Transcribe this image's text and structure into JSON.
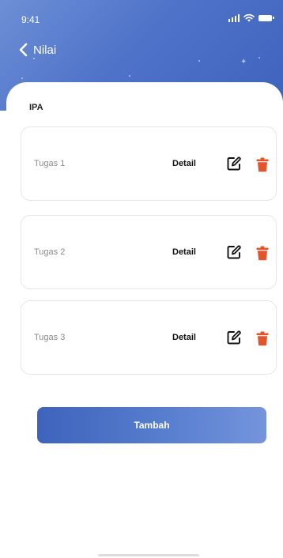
{
  "status_bar": {
    "time": "9:41"
  },
  "header": {
    "title": "Nilai",
    "back_icon": "chevron-left-icon"
  },
  "section": {
    "title": "IPA"
  },
  "items": [
    {
      "label": "Tugas 1",
      "detail_label": "Detail"
    },
    {
      "label": "Tugas 2",
      "detail_label": "Detail"
    },
    {
      "label": "Tugas 3",
      "detail_label": "Detail"
    }
  ],
  "actions": {
    "add_label": "Tambah"
  },
  "colors": {
    "header_gradient_start": "#6d8fd6",
    "header_gradient_end": "#3e63bd",
    "accent": "#3d63bc",
    "delete": "#e2552c"
  }
}
